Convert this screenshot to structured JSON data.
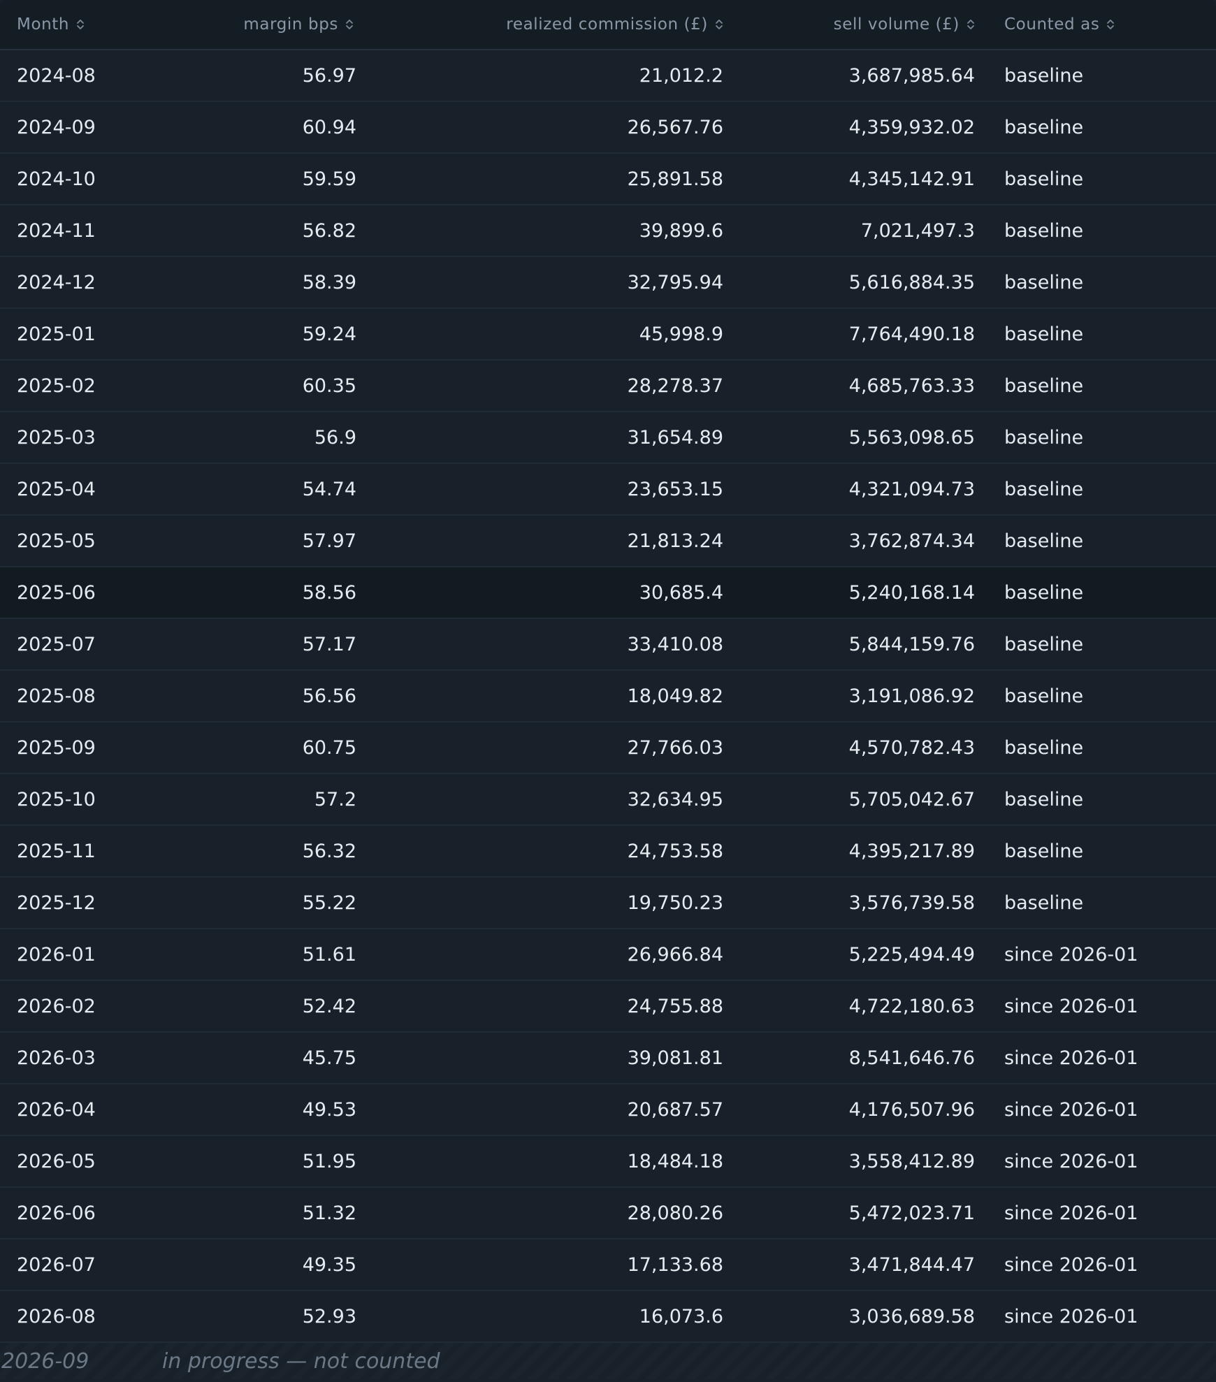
{
  "columns": {
    "month": "Month",
    "margin": "margin bps",
    "commission": "realized commission (£)",
    "sell": "sell volume (£)",
    "counted": "Counted as"
  },
  "rows": [
    {
      "month": "2024-08",
      "margin": "56.97",
      "commission": "21,012.2",
      "sell": "3,687,985.64",
      "counted": "baseline"
    },
    {
      "month": "2024-09",
      "margin": "60.94",
      "commission": "26,567.76",
      "sell": "4,359,932.02",
      "counted": "baseline"
    },
    {
      "month": "2024-10",
      "margin": "59.59",
      "commission": "25,891.58",
      "sell": "4,345,142.91",
      "counted": "baseline"
    },
    {
      "month": "2024-11",
      "margin": "56.82",
      "commission": "39,899.6",
      "sell": "7,021,497.3",
      "counted": "baseline"
    },
    {
      "month": "2024-12",
      "margin": "58.39",
      "commission": "32,795.94",
      "sell": "5,616,884.35",
      "counted": "baseline"
    },
    {
      "month": "2025-01",
      "margin": "59.24",
      "commission": "45,998.9",
      "sell": "7,764,490.18",
      "counted": "baseline"
    },
    {
      "month": "2025-02",
      "margin": "60.35",
      "commission": "28,278.37",
      "sell": "4,685,763.33",
      "counted": "baseline"
    },
    {
      "month": "2025-03",
      "margin": "56.9",
      "commission": "31,654.89",
      "sell": "5,563,098.65",
      "counted": "baseline"
    },
    {
      "month": "2025-04",
      "margin": "54.74",
      "commission": "23,653.15",
      "sell": "4,321,094.73",
      "counted": "baseline"
    },
    {
      "month": "2025-05",
      "margin": "57.97",
      "commission": "21,813.24",
      "sell": "3,762,874.34",
      "counted": "baseline"
    },
    {
      "month": "2025-06",
      "margin": "58.56",
      "commission": "30,685.4",
      "sell": "5,240,168.14",
      "counted": "baseline"
    },
    {
      "month": "2025-07",
      "margin": "57.17",
      "commission": "33,410.08",
      "sell": "5,844,159.76",
      "counted": "baseline"
    },
    {
      "month": "2025-08",
      "margin": "56.56",
      "commission": "18,049.82",
      "sell": "3,191,086.92",
      "counted": "baseline"
    },
    {
      "month": "2025-09",
      "margin": "60.75",
      "commission": "27,766.03",
      "sell": "4,570,782.43",
      "counted": "baseline"
    },
    {
      "month": "2025-10",
      "margin": "57.2",
      "commission": "32,634.95",
      "sell": "5,705,042.67",
      "counted": "baseline"
    },
    {
      "month": "2025-11",
      "margin": "56.32",
      "commission": "24,753.58",
      "sell": "4,395,217.89",
      "counted": "baseline"
    },
    {
      "month": "2025-12",
      "margin": "55.22",
      "commission": "19,750.23",
      "sell": "3,576,739.58",
      "counted": "baseline"
    },
    {
      "month": "2026-01",
      "margin": "51.61",
      "commission": "26,966.84",
      "sell": "5,225,494.49",
      "counted": "since 2026-01"
    },
    {
      "month": "2026-02",
      "margin": "52.42",
      "commission": "24,755.88",
      "sell": "4,722,180.63",
      "counted": "since 2026-01"
    },
    {
      "month": "2026-03",
      "margin": "45.75",
      "commission": "39,081.81",
      "sell": "8,541,646.76",
      "counted": "since 2026-01"
    },
    {
      "month": "2026-04",
      "margin": "49.53",
      "commission": "20,687.57",
      "sell": "4,176,507.96",
      "counted": "since 2026-01"
    },
    {
      "month": "2026-05",
      "margin": "51.95",
      "commission": "18,484.18",
      "sell": "3,558,412.89",
      "counted": "since 2026-01"
    },
    {
      "month": "2026-06",
      "margin": "51.32",
      "commission": "28,080.26",
      "sell": "5,472,023.71",
      "counted": "since 2026-01"
    },
    {
      "month": "2026-07",
      "margin": "49.35",
      "commission": "17,133.68",
      "sell": "3,471,844.47",
      "counted": "since 2026-01"
    },
    {
      "month": "2026-08",
      "margin": "52.93",
      "commission": "16,073.6",
      "sell": "3,036,689.58",
      "counted": "since 2026-01"
    }
  ],
  "highlighted_row_month": "2025-06",
  "footer": {
    "month": "2026-09",
    "note": "in progress — not counted"
  },
  "icons": {
    "sort": "sort-updown-icon"
  },
  "colors": {
    "background": "#18212a",
    "header_background": "#141c24",
    "header_text": "#8a98a8",
    "row_text": "#e6ebf0",
    "row_border": "#212b35",
    "footer_text": "#6b7886"
  }
}
